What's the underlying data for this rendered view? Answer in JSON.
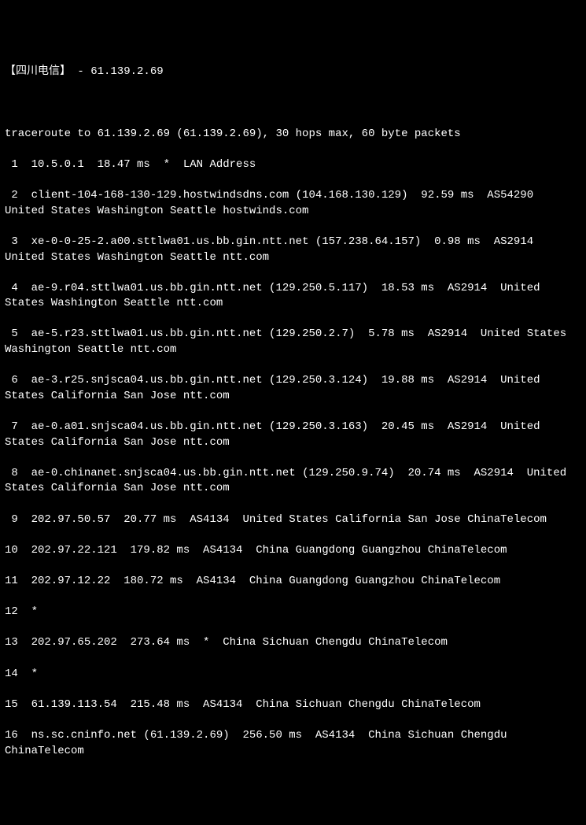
{
  "title": "【四川电信】 - 61.139.2.69",
  "header": "traceroute to 61.139.2.69 (61.139.2.69), 30 hops max, 60 byte packets",
  "hops": [
    " 1  10.5.0.1  18.47 ms  *  LAN Address",
    " 2  client-104-168-130-129.hostwindsdns.com (104.168.130.129)  92.59 ms  AS54290  United States Washington Seattle hostwinds.com",
    " 3  xe-0-0-25-2.a00.sttlwa01.us.bb.gin.ntt.net (157.238.64.157)  0.98 ms  AS2914  United States Washington Seattle ntt.com",
    " 4  ae-9.r04.sttlwa01.us.bb.gin.ntt.net (129.250.5.117)  18.53 ms  AS2914  United States Washington Seattle ntt.com",
    " 5  ae-5.r23.sttlwa01.us.bb.gin.ntt.net (129.250.2.7)  5.78 ms  AS2914  United States Washington Seattle ntt.com",
    " 6  ae-3.r25.snjsca04.us.bb.gin.ntt.net (129.250.3.124)  19.88 ms  AS2914  United States California San Jose ntt.com",
    " 7  ae-0.a01.snjsca04.us.bb.gin.ntt.net (129.250.3.163)  20.45 ms  AS2914  United States California San Jose ntt.com",
    " 8  ae-0.chinanet.snjsca04.us.bb.gin.ntt.net (129.250.9.74)  20.74 ms  AS2914  United States California San Jose ntt.com",
    " 9  202.97.50.57  20.77 ms  AS4134  United States California San Jose ChinaTelecom",
    "10  202.97.22.121  179.82 ms  AS4134  China Guangdong Guangzhou ChinaTelecom",
    "11  202.97.12.22  180.72 ms  AS4134  China Guangdong Guangzhou ChinaTelecom",
    "12  *",
    "13  202.97.65.202  273.64 ms  *  China Sichuan Chengdu ChinaTelecom",
    "14  *",
    "15  61.139.113.54  215.48 ms  AS4134  China Sichuan Chengdu ChinaTelecom",
    "16  ns.sc.cninfo.net (61.139.2.69)  256.50 ms  AS4134  China Sichuan Chengdu ChinaTelecom"
  ]
}
